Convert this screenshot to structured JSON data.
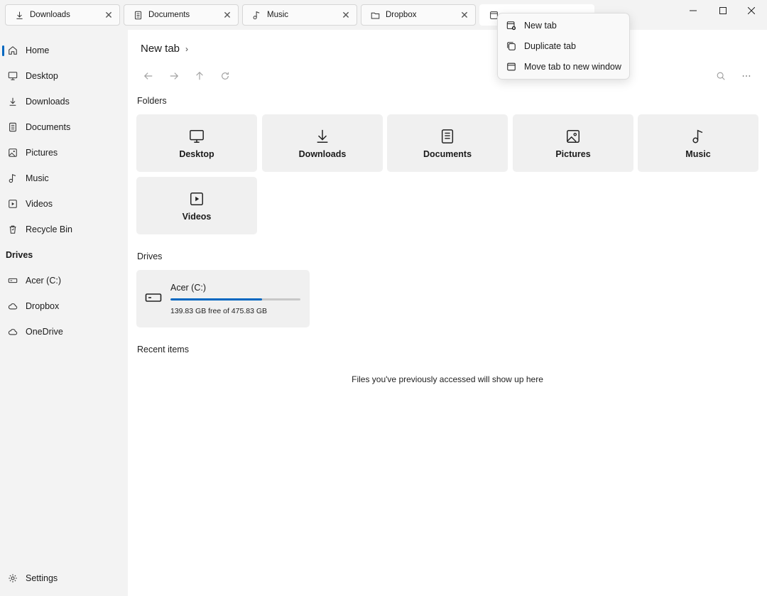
{
  "tabs": [
    {
      "label": "Downloads",
      "icon": "download-icon"
    },
    {
      "label": "Documents",
      "icon": "document-icon"
    },
    {
      "label": "Music",
      "icon": "music-icon"
    },
    {
      "label": "Dropbox",
      "icon": "folder-icon"
    }
  ],
  "sidebar": {
    "items": [
      {
        "label": "Home",
        "icon": "home-icon"
      },
      {
        "label": "Desktop",
        "icon": "desktop-icon"
      },
      {
        "label": "Downloads",
        "icon": "download-icon"
      },
      {
        "label": "Documents",
        "icon": "document-icon"
      },
      {
        "label": "Pictures",
        "icon": "picture-icon"
      },
      {
        "label": "Music",
        "icon": "music-icon"
      },
      {
        "label": "Videos",
        "icon": "video-icon"
      },
      {
        "label": "Recycle Bin",
        "icon": "recycle-bin-icon"
      }
    ],
    "drives_heading": "Drives",
    "drives": [
      {
        "label": "Acer (C:)",
        "icon": "drive-icon"
      },
      {
        "label": "Dropbox",
        "icon": "cloud-icon"
      },
      {
        "label": "OneDrive",
        "icon": "cloud-icon"
      }
    ],
    "settings_label": "Settings"
  },
  "main": {
    "breadcrumb": "New tab",
    "folders_heading": "Folders",
    "folders": [
      {
        "label": "Desktop",
        "icon": "desktop-icon"
      },
      {
        "label": "Downloads",
        "icon": "download-icon"
      },
      {
        "label": "Documents",
        "icon": "document-icon"
      },
      {
        "label": "Pictures",
        "icon": "picture-icon"
      },
      {
        "label": "Music",
        "icon": "music-icon"
      },
      {
        "label": "Videos",
        "icon": "video-icon"
      }
    ],
    "drives_heading": "Drives",
    "drive": {
      "name": "Acer (C:)",
      "free_text": "139.83 GB free of 475.83 GB",
      "used_fraction": 0.706
    },
    "recent_heading": "Recent items",
    "recent_empty": "Files you've previously accessed will show up here"
  },
  "context_menu": {
    "items": [
      {
        "label": "New tab",
        "icon": "new-tab-icon"
      },
      {
        "label": "Duplicate tab",
        "icon": "duplicate-tab-icon"
      },
      {
        "label": "Move tab to new window",
        "icon": "new-window-icon"
      }
    ]
  },
  "colors": {
    "accent": "#0067c0"
  }
}
